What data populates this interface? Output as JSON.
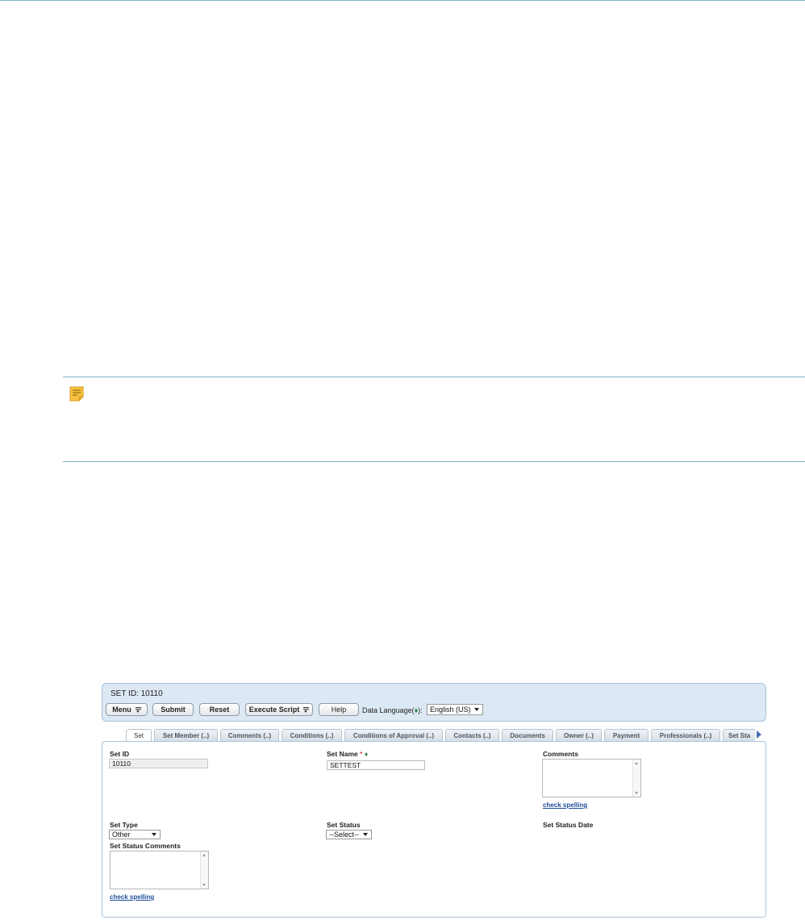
{
  "app": {
    "set_title": "SET ID: 10110",
    "toolbar": {
      "menu_label": "Menu",
      "submit_label": "Submit",
      "reset_label": "Reset",
      "execute_script_label": "Execute Script",
      "help_label": "Help",
      "data_language_label": "Data Language(",
      "data_language_suffix": "):",
      "data_language_value": "English (US)"
    },
    "tabs": [
      {
        "label": "Set",
        "active": true
      },
      {
        "label": "Set Member (..)"
      },
      {
        "label": "Comments (..)"
      },
      {
        "label": "Conditions (..)"
      },
      {
        "label": "Conditions of Approval (..)"
      },
      {
        "label": "Contacts (..)"
      },
      {
        "label": "Documents"
      },
      {
        "label": "Owner (..)"
      },
      {
        "label": "Payment"
      },
      {
        "label": "Professionals (..)"
      },
      {
        "label": "Set Sta"
      }
    ],
    "form": {
      "set_id": {
        "label": "Set ID",
        "value": "10110"
      },
      "set_name": {
        "label": "Set Name",
        "required_mark": "*",
        "value": "SETTEST"
      },
      "comments": {
        "label": "Comments",
        "check_spelling": "check spelling"
      },
      "set_type": {
        "label": "Set Type",
        "value": "Other"
      },
      "set_status": {
        "label": "Set Status",
        "value": "--Select--"
      },
      "set_status_date": {
        "label": "Set Status Date"
      },
      "set_status_comments": {
        "label": "Set Status Comments",
        "check_spelling": "check spelling"
      }
    }
  },
  "icons": {
    "note": "note-icon",
    "language_marker": "diamond-icon",
    "tab_scroll": "scroll-right-arrow-icon"
  },
  "colors": {
    "rule": "#7fb3c4",
    "header_bg": "#dce8f3",
    "link": "#1f4f95",
    "note_icon": "#f2b733"
  }
}
